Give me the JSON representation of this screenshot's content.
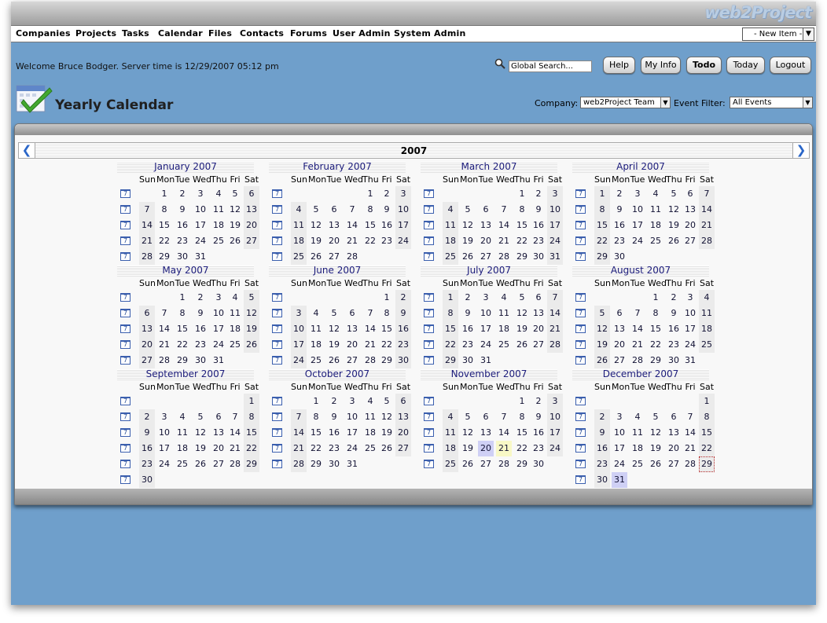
{
  "app": {
    "logo": "web2Project",
    "nav": [
      "Companies",
      "Projects",
      "Tasks",
      "Calendar",
      "Files",
      "Contacts",
      "Forums",
      "User Admin",
      "System Admin"
    ],
    "new_item": "- New Item -"
  },
  "header": {
    "welcome": "Welcome Bruce Bodger. Server time is 12/29/2007 05:12 pm",
    "search_value": "Global Search...",
    "buttons": [
      "Help",
      "My Info",
      "Todo",
      "Today",
      "Logout"
    ]
  },
  "page": {
    "title": "Yearly Calendar",
    "company_label": "Company:",
    "company_value": "web2Project Team",
    "filter_label": "Event Filter:",
    "filter_value": "All Events"
  },
  "calendar": {
    "year": "2007",
    "week_icon": "7",
    "dow": [
      "Sun",
      "Mon",
      "Tue",
      "Wed",
      "Thu",
      "Fri",
      "Sat"
    ],
    "months": [
      {
        "name": "January 2007",
        "start": 1,
        "days": 31
      },
      {
        "name": "February 2007",
        "start": 4,
        "days": 28
      },
      {
        "name": "March 2007",
        "start": 4,
        "days": 31
      },
      {
        "name": "April 2007",
        "start": 0,
        "days": 30
      },
      {
        "name": "May 2007",
        "start": 2,
        "days": 31
      },
      {
        "name": "June 2007",
        "start": 5,
        "days": 30
      },
      {
        "name": "July 2007",
        "start": 0,
        "days": 31
      },
      {
        "name": "August 2007",
        "start": 3,
        "days": 31
      },
      {
        "name": "September 2007",
        "start": 6,
        "days": 30
      },
      {
        "name": "October 2007",
        "start": 1,
        "days": 31
      },
      {
        "name": "November 2007",
        "start": 4,
        "days": 30
      },
      {
        "name": "December 2007",
        "start": 6,
        "days": 31
      }
    ],
    "highlighted": [
      {
        "month": 11,
        "day": 20,
        "color": "#cfd0f5"
      },
      {
        "month": 11,
        "day": 21,
        "color": "#f8f8c6"
      },
      {
        "month": 12,
        "day": 31,
        "color": "#cfd0f5"
      }
    ],
    "today": {
      "month": 12,
      "day": 29
    }
  }
}
